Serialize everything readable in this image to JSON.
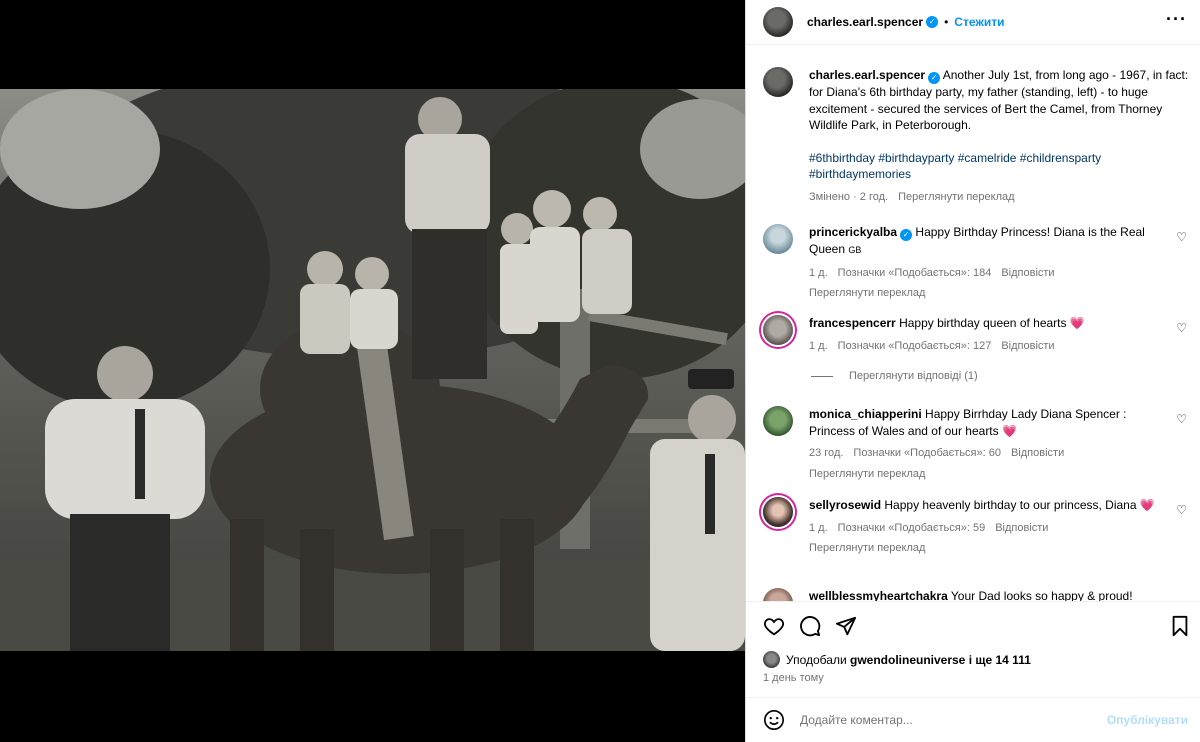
{
  "post": {
    "username": "charles.earl.spencer",
    "follow_label": "Стежити",
    "more_icon": "more-horizontal-icon",
    "caption": "Another July 1st, from long ago - 1967, in fact: for Diana's 6th birthday party, my father (standing, left) - to huge excitement - secured the services of Bert the Camel, from Thorney Wildlife Park, in Peterborough.",
    "hashtags": "#6thbirthday #birthdayparty #camelride #childrensparty #birthdaymemories",
    "edited": "Змінено · 2 год.",
    "see_translation": "Переглянути переклад"
  },
  "comments": [
    {
      "username": "princerickyalba",
      "verified": true,
      "text": "Happy Birthday Princess! Diana is the Real Queen",
      "flag": "GB",
      "time": "1 д.",
      "likes": "Позначки «Подобається»: 184",
      "reply": "Відповісти",
      "translate": "Переглянути переклад"
    },
    {
      "username": "francespencerr",
      "text": "Happy birthday queen of hearts",
      "heart": "💗",
      "time": "1 д.",
      "likes": "Позначки «Подобається»: 127",
      "reply": "Відповісти",
      "view_replies": "Переглянути відповіді (1)"
    },
    {
      "username": "monica_chiapperini",
      "text": "Happy Birrhday Lady Diana Spencer : Princess of Wales and of our hearts",
      "heart": "💗",
      "time": "23 год.",
      "likes": "Позначки «Подобається»: 60",
      "reply": "Відповісти",
      "translate": "Переглянути переклад"
    },
    {
      "username": "sellyrosewid",
      "text": "Happy heavenly birthday to our princess, Diana",
      "heart": "💗",
      "time": "1 д.",
      "likes": "Позначки «Подобається»: 59",
      "reply": "Відповісти",
      "translate": "Переглянути переклад"
    },
    {
      "username": "wellblessmyheartchakra",
      "text": "Your Dad looks so happy & proud!"
    }
  ],
  "actions": {
    "like_icon": "heart-icon",
    "comment_icon": "comment-icon",
    "share_icon": "send-icon",
    "save_icon": "bookmark-icon"
  },
  "likes_line": {
    "prefix": "Уподобали",
    "user": "gwendolineuniverse",
    "suffix": "і ще 14 111"
  },
  "timestamp": "1 день тому",
  "comment_box": {
    "placeholder": "Додайте коментар...",
    "post_label": "Опублікувати",
    "emoji_icon": "smiley-icon"
  },
  "colors": {
    "accent": "#0095f6",
    "link": "#00376b",
    "muted": "#737373",
    "heart": "#ed4956"
  }
}
